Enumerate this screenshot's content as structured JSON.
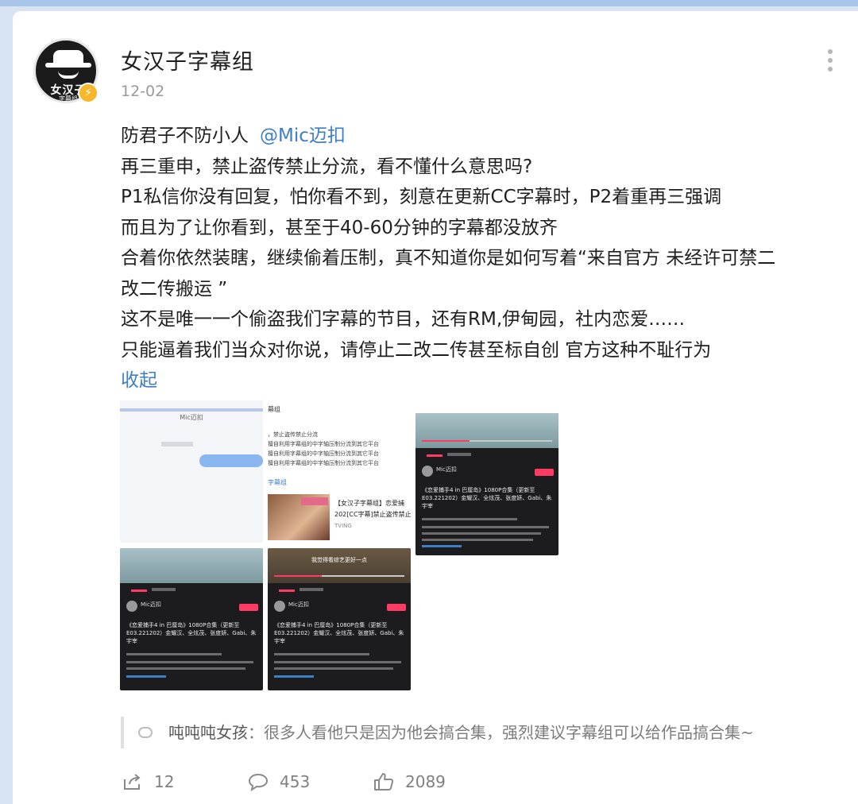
{
  "post": {
    "author": "女汉子字幕组",
    "date": "12-02",
    "avatar_text": "女汉子",
    "avatar_subtext": "字幕组",
    "verified_badge": "⚡",
    "lines": [
      "防君子不防小人",
      "再三重申，禁止盗传禁止分流，看不懂什么意思吗?",
      "P1私信你没有回复，怕你看不到，刻意在更新CC字幕时，P2着重再三强调",
      "而且为了让你看到，甚至于40-60分钟的字幕都没放齐",
      "合着你依然装瞎，继续偷着压制，真不知道你是如何写着“来自官方 未经许可禁二",
      "改二传搬运 ”",
      "这不是唯一一个偷盗我们字幕的节目，还有RM,伊甸园，社内恋爱……",
      "只能逼着我们当众对你说，请停止二改二传甚至标自创 官方这种不耻行为"
    ],
    "mention": "@Mic迈扣",
    "collapse_label": "收起"
  },
  "thumbnails": {
    "t1_title": "Mic迈扣",
    "t2_header": "幕组",
    "t2_line1": "，禁止盗传禁止分流",
    "t2_line2": "擅自利用字幕组的中字轴压制分流到其它平台",
    "t2_line3": "擅自利用字幕组的中字轴压制分流到其它平台",
    "t2_line4": "擅自利用字幕组的中字轴压制分流到其它平台",
    "t2_link": "字幕组",
    "t2_title": "【女汉子字幕组】恋爱捕",
    "t2_sub": "202[CC字幕]禁止盗传禁止",
    "t2_source": "TVING",
    "dark_title": "《恋爱捕手4 in 巴厘岛》1080P合集（更新至E03.221202）金耀汉、全炫茂、张度妍、Gabi、朱宇宰",
    "dark_user": "Mic迈扣",
    "dark_follow": "+ 关注",
    "t5_banner": "我觉得看综艺更好一点"
  },
  "comment": {
    "name": "吨吨吨女孩",
    "text": "：很多人看他只是因为他会搞合集，强烈建议字幕组可以给作品搞合集~"
  },
  "actions": {
    "share_count": "12",
    "comment_count": "453",
    "like_count": "2089"
  }
}
